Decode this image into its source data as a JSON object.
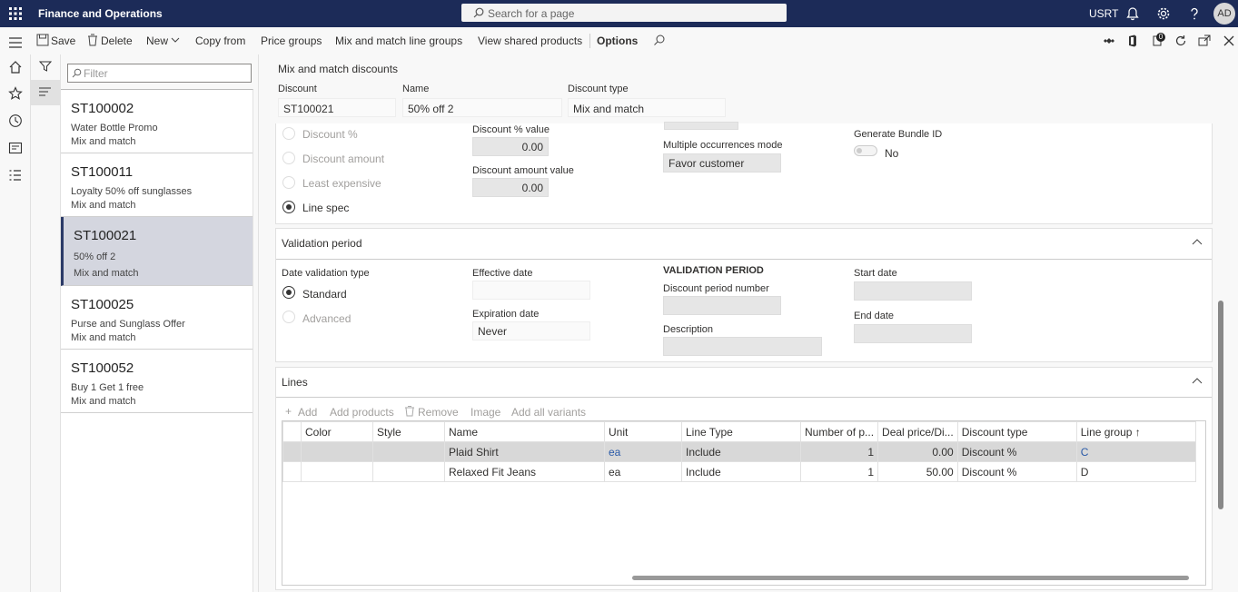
{
  "top": {
    "title": "Finance and Operations",
    "search_placeholder": "Search for a page",
    "company": "USRT",
    "user_initials": "AD"
  },
  "actions": {
    "save": "Save",
    "delete": "Delete",
    "new": "New",
    "copy_from": "Copy from",
    "price_groups": "Price groups",
    "mix_match_groups": "Mix and match line groups",
    "view_shared": "View shared products",
    "options": "Options",
    "badge": "0"
  },
  "filter": {
    "placeholder": "Filter"
  },
  "list": [
    {
      "id": "ST100002",
      "name": "Water Bottle Promo",
      "type": "Mix and match"
    },
    {
      "id": "ST100011",
      "name": "Loyalty 50% off sunglasses",
      "type": "Mix and match"
    },
    {
      "id": "ST100021",
      "name": "50% off 2",
      "type": "Mix and match"
    },
    {
      "id": "ST100025",
      "name": "Purse and Sunglass Offer",
      "type": "Mix and match"
    },
    {
      "id": "ST100052",
      "name": "Buy 1 Get 1 free",
      "type": "Mix and match"
    }
  ],
  "header": {
    "section": "Mix and match discounts",
    "discount_label": "Discount",
    "discount_value": "ST100021",
    "name_label": "Name",
    "name_value": "50% off 2",
    "type_label": "Discount type",
    "type_value": "Mix and match"
  },
  "config": {
    "opt_pct": "Discount %",
    "opt_amount": "Discount amount",
    "opt_least": "Least expensive",
    "opt_linespec": "Line spec",
    "pct_value_label": "Discount % value",
    "pct_value": "0.00",
    "amount_value_label": "Discount amount value",
    "amount_value": "0.00",
    "occ_label": "Multiple occurrences mode",
    "occ_value": "Favor customer",
    "bundle_label": "Generate Bundle ID",
    "bundle_value": "No"
  },
  "validation": {
    "title": "Validation period",
    "dv_type_label": "Date validation type",
    "standard": "Standard",
    "advanced": "Advanced",
    "eff_label": "Effective date",
    "eff_value": "",
    "exp_label": "Expiration date",
    "exp_value": "Never",
    "vp_heading": "VALIDATION PERIOD",
    "dpn_label": "Discount period number",
    "desc_label": "Description",
    "start_label": "Start date",
    "end_label": "End date"
  },
  "lines": {
    "title": "Lines",
    "add": "Add",
    "add_products": "Add products",
    "remove": "Remove",
    "image": "Image",
    "add_variants": "Add all variants",
    "columns": [
      "Color",
      "Style",
      "Name",
      "Unit",
      "Line Type",
      "Number of p...",
      "Deal price/Di...",
      "Discount type",
      "Line group"
    ],
    "rows": [
      {
        "color": "",
        "style": "",
        "name": "Plaid Shirt",
        "unit": "ea",
        "line_type": "Include",
        "num": "1",
        "deal": "0.00",
        "dtype": "Discount %",
        "group": "C"
      },
      {
        "color": "",
        "style": "",
        "name": "Relaxed Fit Jeans",
        "unit": "ea",
        "line_type": "Include",
        "num": "1",
        "deal": "50.00",
        "dtype": "Discount %",
        "group": "D"
      }
    ]
  }
}
